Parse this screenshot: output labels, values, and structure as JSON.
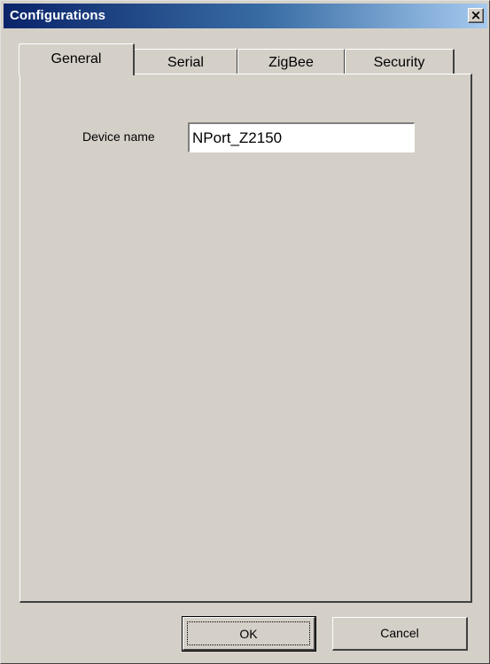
{
  "window": {
    "title": "Configurations",
    "close_glyph": "✕"
  },
  "tabs": [
    {
      "label": "General",
      "selected": true
    },
    {
      "label": "Serial",
      "selected": false
    },
    {
      "label": "ZigBee",
      "selected": false
    },
    {
      "label": "Security",
      "selected": false
    }
  ],
  "general": {
    "device_name_label": "Device name",
    "device_name_value": "NPort_Z2150"
  },
  "buttons": {
    "ok_label": "OK",
    "cancel_label": "Cancel"
  },
  "colors": {
    "titlebar_start": "#0a246a",
    "titlebar_end": "#a6caf0",
    "face": "#d4d0c8"
  }
}
